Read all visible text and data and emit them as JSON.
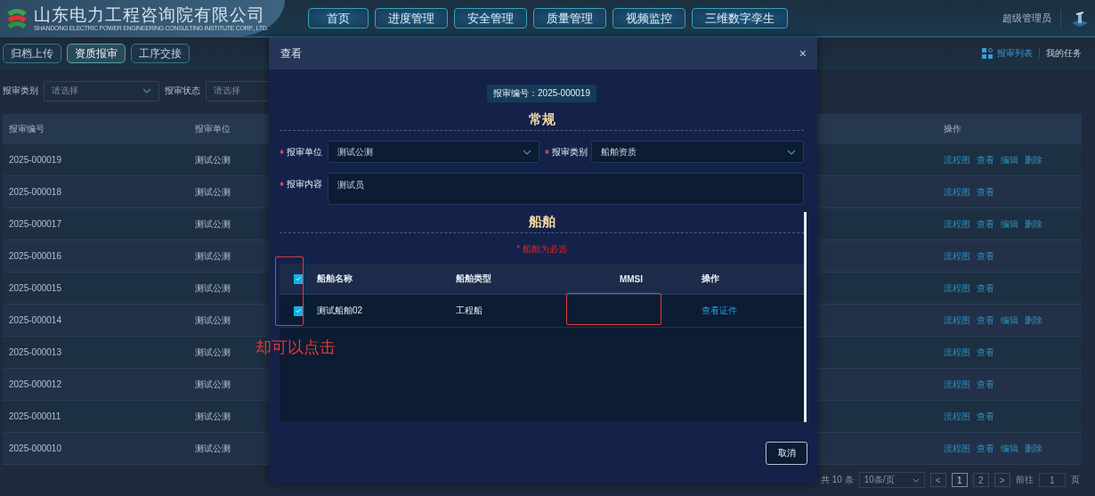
{
  "header": {
    "company": "山东电力工程咨询院有限公司",
    "company_en": "SHANDONG ELECTRIC POWER ENGINEERING CONSULTING INSTITUTE CORP., LTD.",
    "nav": [
      "首页",
      "进度管理",
      "安全管理",
      "质量管理",
      "视频监控",
      "三维数字孪生"
    ],
    "user": "超级管理员"
  },
  "tabs": [
    {
      "label": "归档上传",
      "selected": false
    },
    {
      "label": "资质报审",
      "selected": true
    },
    {
      "label": "工序交接",
      "selected": false
    }
  ],
  "views": [
    {
      "label": "报审列表",
      "selected": true
    },
    {
      "label": "我的任务",
      "selected": false
    }
  ],
  "filters": [
    {
      "label": "报审类别",
      "placeholder": "请选择"
    },
    {
      "label": "报审状态",
      "placeholder": "请选择"
    }
  ],
  "table": {
    "columns": [
      "报审编号",
      "报审单位",
      "操作"
    ],
    "rows": [
      {
        "id": "2025-000019",
        "unit": "测试公测",
        "actions": [
          "流程图",
          "查看",
          "编辑",
          "删除"
        ]
      },
      {
        "id": "2025-000018",
        "unit": "测试公测",
        "actions": [
          "流程图",
          "查看"
        ]
      },
      {
        "id": "2025-000017",
        "unit": "测试公测",
        "actions": [
          "流程图",
          "查看",
          "编辑",
          "删除"
        ]
      },
      {
        "id": "2025-000016",
        "unit": "测试公测",
        "actions": [
          "流程图",
          "查看"
        ]
      },
      {
        "id": "2025-000015",
        "unit": "测试公测",
        "actions": [
          "流程图",
          "查看"
        ]
      },
      {
        "id": "2025-000014",
        "unit": "测试公测",
        "actions": [
          "流程图",
          "查看",
          "编辑",
          "删除"
        ]
      },
      {
        "id": "2025-000013",
        "unit": "测试公测",
        "actions": [
          "流程图",
          "查看"
        ]
      },
      {
        "id": "2025-000012",
        "unit": "测试公测",
        "actions": [
          "流程图",
          "查看"
        ]
      },
      {
        "id": "2025-000011",
        "unit": "测试公测",
        "actions": [
          "流程图",
          "查看"
        ]
      },
      {
        "id": "2025-000010",
        "unit": "测试公测",
        "actions": [
          "流程图",
          "查看",
          "编辑",
          "删除"
        ]
      }
    ]
  },
  "pagination": {
    "total": "共 10 条",
    "page_size": "10条/页",
    "prev": "<",
    "next": ">",
    "pages": [
      {
        "label": "1",
        "selected": true
      },
      {
        "label": "2",
        "selected": false
      }
    ],
    "goto_label": "前往",
    "goto_value": "1",
    "goto_suffix": "页"
  },
  "dialog": {
    "title": "查看",
    "close": "×",
    "number": "报审编号：2025-000019",
    "general_title": "常规",
    "fields": [
      {
        "label": "报审单位",
        "required": true,
        "kind": "select",
        "value": "测试公测"
      },
      {
        "label": "报审类别",
        "required": true,
        "kind": "select",
        "value": "船舶资质"
      },
      {
        "label": "报审内容",
        "required": true,
        "kind": "textarea",
        "value": "测试员"
      }
    ],
    "ship_title": "船舶",
    "ship_hint": "* 船舶为必选",
    "ship_table": {
      "all_checked": true,
      "columns": [
        "船舶名称",
        "船舶类型",
        "MMSI",
        "操作"
      ],
      "rows": [
        {
          "checked": true,
          "name": "测试船舶02",
          "type": "工程船",
          "action": "查看证件"
        }
      ]
    },
    "cancel": "取消"
  },
  "annotation": {
    "text": "却可以点击"
  }
}
